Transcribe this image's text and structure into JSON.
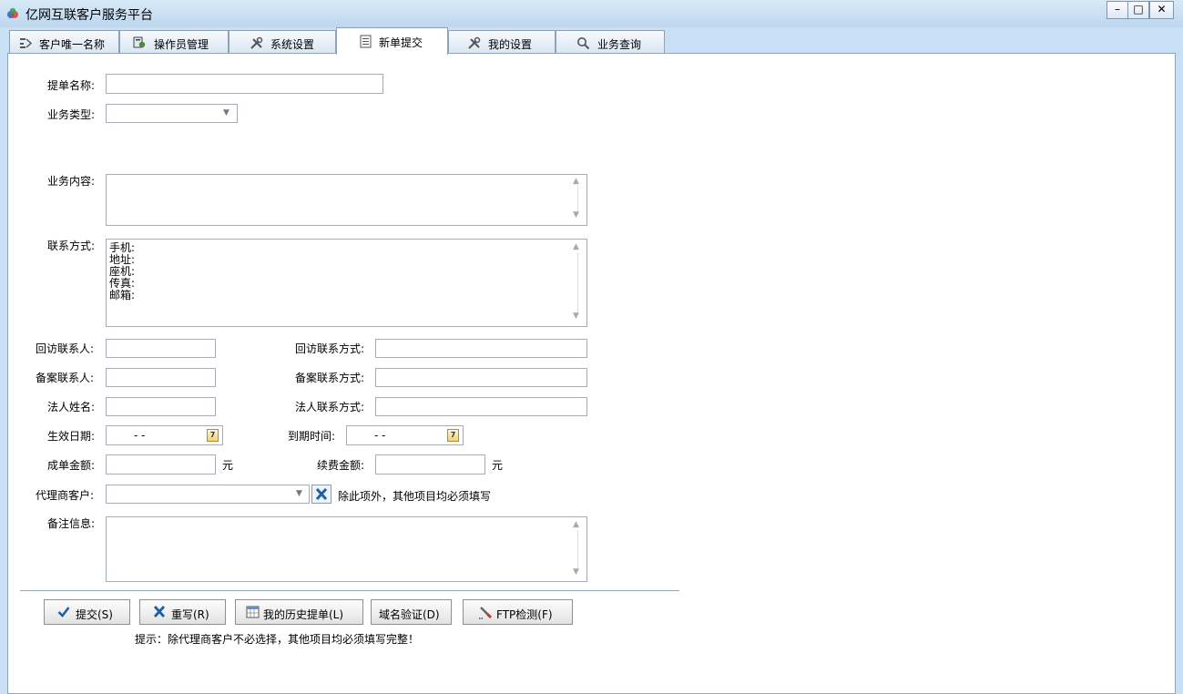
{
  "window": {
    "title": "亿网互联客户服务平台",
    "minimize": "–",
    "maximize": "□",
    "close": "✕"
  },
  "tabs": [
    {
      "label": "客户唯一名称",
      "icon": "customer-icon"
    },
    {
      "label": "操作员管理",
      "icon": "operator-icon"
    },
    {
      "label": "系统设置",
      "icon": "tools-icon"
    },
    {
      "label": "新单提交",
      "icon": "document-icon",
      "active": true
    },
    {
      "label": "我的设置",
      "icon": "tools-icon"
    },
    {
      "label": "业务查询",
      "icon": "search-icon"
    }
  ],
  "form": {
    "order_name_label": "提单名称:",
    "order_name_value": "",
    "business_type_label": "业务类型:",
    "business_type_value": "",
    "business_content_label": "业务内容:",
    "business_content_value": "",
    "contact_label": "联系方式:",
    "contact_lines": [
      "手机:",
      "地址:",
      "座机:",
      "传真:",
      "邮箱:"
    ],
    "visit_contact_label": "回访联系人:",
    "visit_method_label": "回访联系方式:",
    "filing_contact_label": "备案联系人:",
    "filing_method_label": "备案联系方式:",
    "legal_name_label": "法人姓名:",
    "legal_method_label": "法人联系方式:",
    "effective_date_label": "生效日期:",
    "effective_date_value": "-  -",
    "expiry_date_label": "到期时间:",
    "expiry_date_value": "-  -",
    "calendar_day": "7",
    "order_amount_label": "成单金额:",
    "renewal_amount_label": "续费金额:",
    "currency_unit": "元",
    "agent_customer_label": "代理商客户:",
    "agent_customer_value": "",
    "agent_note": "除此项外，其他项目均必须填写",
    "remarks_label": "备注信息:",
    "remarks_value": ""
  },
  "buttons": {
    "submit": "提交(S)",
    "reset": "重写(R)",
    "history": "我的历史提单(L)",
    "domain_verify": "域名验证(D)",
    "ftp_check": "FTP检测(F)"
  },
  "hint": "提示：除代理商客户不必选择，其他项目均必须填写完整！",
  "colors": {
    "accent": "#1f5fa8",
    "titlebar": "#bcd6ee",
    "border": "#8ba4bb"
  }
}
